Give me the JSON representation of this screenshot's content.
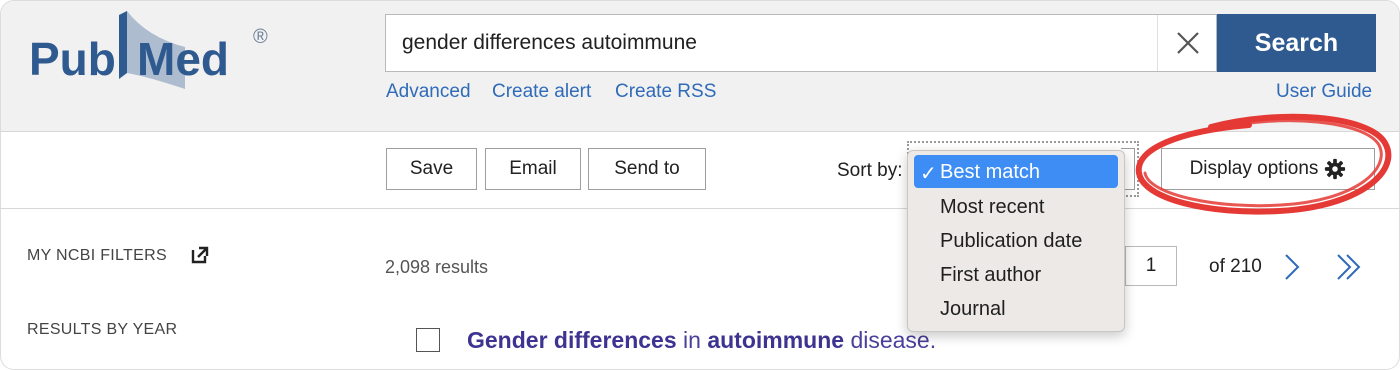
{
  "brand": {
    "logo_text_left": "Pub",
    "logo_text_right": "Med",
    "registered": "®",
    "logo_color": "#2f5a8f"
  },
  "search": {
    "query": "gender differences autoimmune",
    "clear_icon": "close-icon",
    "button_label": "Search",
    "button_color": "#2f5a8f"
  },
  "header_links": {
    "advanced": "Advanced",
    "create_alert": "Create alert",
    "create_rss": "Create RSS",
    "user_guide": "User Guide",
    "link_color": "#2f6bb8"
  },
  "toolbar": {
    "save": "Save",
    "email": "Email",
    "send_to": "Send to",
    "sort_label": "Sort by:",
    "display_options": "Display options",
    "display_icon": "gear-icon"
  },
  "sort_dropdown": {
    "selected": "Best match",
    "check": "✓",
    "options": [
      "Best match",
      "Most recent",
      "Publication date",
      "First author",
      "Journal"
    ],
    "highlight_color": "#3d8df5"
  },
  "sidebar": {
    "my_ncbi_filters": "MY NCBI FILTERS",
    "results_by_year": "RESULTS BY YEAR"
  },
  "results": {
    "count": "2,098 results",
    "current_page": "1",
    "of_pages": "of 210"
  },
  "article": {
    "title_part1": "Gender differences",
    "title_part2": " in ",
    "title_part3": "autoimmune",
    "title_part4": " disease."
  },
  "annotation": {
    "shape": "hand-drawn circle around Display options",
    "color": "#e53935"
  }
}
